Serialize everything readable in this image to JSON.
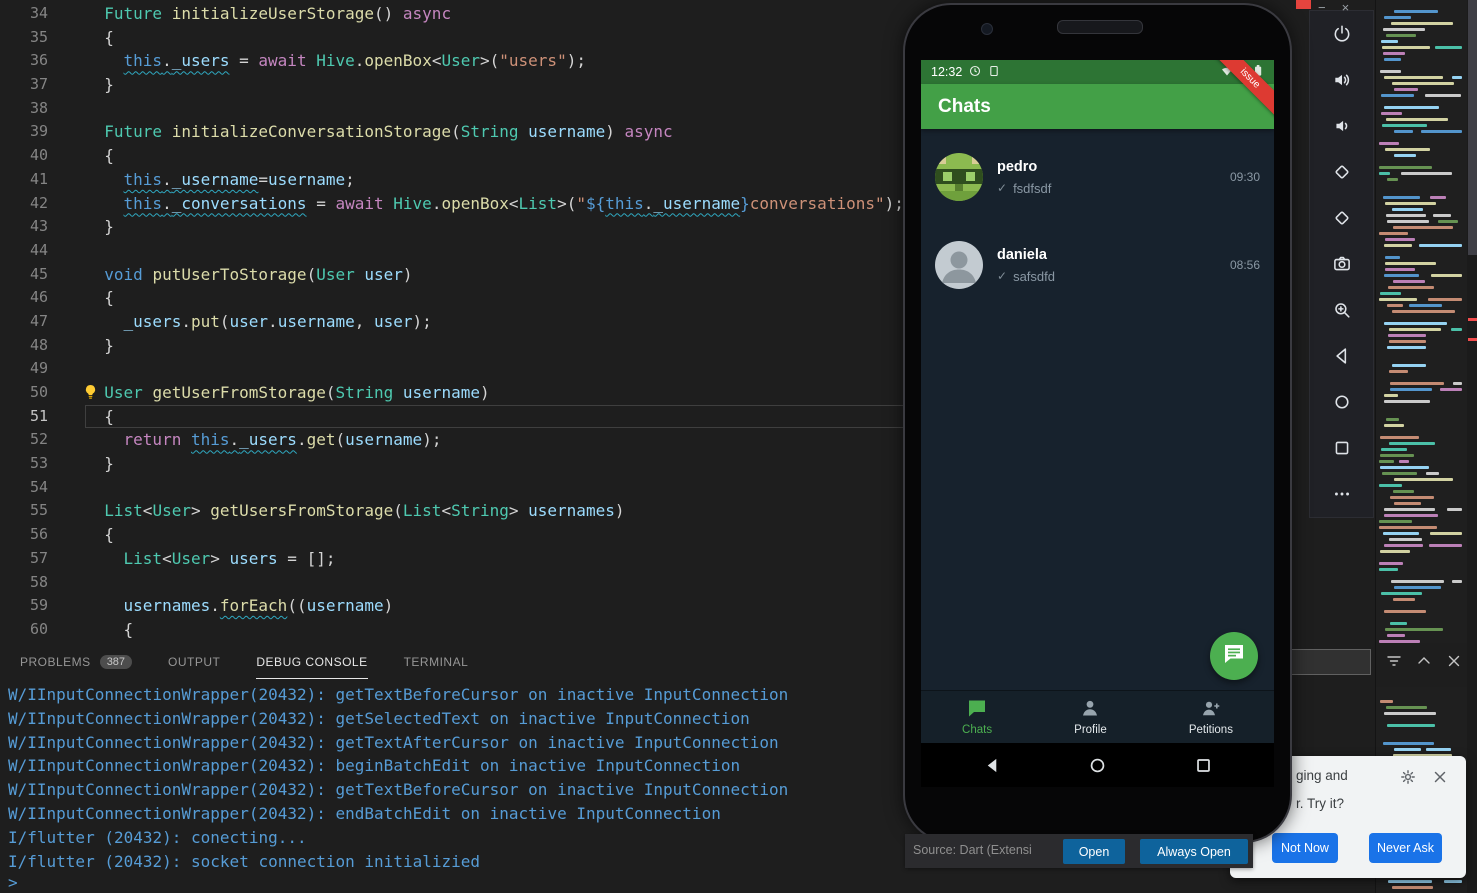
{
  "colors": {
    "app_bar_green": "#43A047",
    "status_bar_green": "#2D7434",
    "accent_green": "#4CAF50",
    "phone_bg_navy": "#17222D",
    "banner_red": "#DD3A32",
    "console_blue": "#569CD6",
    "vscode_button_blue": "#0E639C",
    "emulator_button_blue": "#1A73E8"
  },
  "editor": {
    "current_line": 51,
    "lightbulb_line": 50,
    "lines": [
      {
        "n": 34,
        "t": [
          [
            "  ",
            "pl"
          ],
          [
            "Future",
            "ty"
          ],
          [
            " ",
            "pl"
          ],
          [
            "initializeUserStorage",
            "fn"
          ],
          [
            "() ",
            "pl"
          ],
          [
            "async",
            "ctl"
          ]
        ]
      },
      {
        "n": 35,
        "t": [
          [
            "  {",
            "pl"
          ]
        ]
      },
      {
        "n": 36,
        "t": [
          [
            "    ",
            "pl"
          ],
          [
            "this",
            "kw",
            "w"
          ],
          [
            ".",
            "pl",
            "w"
          ],
          [
            "_users",
            "var",
            "w"
          ],
          [
            " = ",
            "pl"
          ],
          [
            "await",
            "ctl"
          ],
          [
            " ",
            "pl"
          ],
          [
            "Hive",
            "ty"
          ],
          [
            ".",
            "pl"
          ],
          [
            "openBox",
            "fn"
          ],
          [
            "<",
            "pl"
          ],
          [
            "User",
            "ty"
          ],
          [
            ">(",
            "pl"
          ],
          [
            "\"users\"",
            "str"
          ],
          [
            ");",
            "pl"
          ]
        ]
      },
      {
        "n": 37,
        "t": [
          [
            "  }",
            "pl"
          ]
        ]
      },
      {
        "n": 38,
        "t": []
      },
      {
        "n": 39,
        "t": [
          [
            "  ",
            "pl"
          ],
          [
            "Future",
            "ty"
          ],
          [
            " ",
            "pl"
          ],
          [
            "initializeConversationStorage",
            "fn"
          ],
          [
            "(",
            "pl"
          ],
          [
            "String",
            "ty"
          ],
          [
            " ",
            "pl"
          ],
          [
            "username",
            "var"
          ],
          [
            ") ",
            "pl"
          ],
          [
            "async",
            "ctl"
          ]
        ]
      },
      {
        "n": 40,
        "t": [
          [
            "  {",
            "pl"
          ]
        ]
      },
      {
        "n": 41,
        "t": [
          [
            "    ",
            "pl"
          ],
          [
            "this",
            "kw",
            "w"
          ],
          [
            ".",
            "pl",
            "w"
          ],
          [
            "_username",
            "var",
            "w"
          ],
          [
            "=",
            "pl"
          ],
          [
            "username",
            "var"
          ],
          [
            ";",
            "pl"
          ]
        ]
      },
      {
        "n": 42,
        "t": [
          [
            "    ",
            "pl"
          ],
          [
            "this",
            "kw",
            "w"
          ],
          [
            ".",
            "pl",
            "w"
          ],
          [
            "_conversations",
            "var",
            "w"
          ],
          [
            " = ",
            "pl"
          ],
          [
            "await",
            "ctl"
          ],
          [
            " ",
            "pl"
          ],
          [
            "Hive",
            "ty"
          ],
          [
            ".",
            "pl"
          ],
          [
            "openBox",
            "fn"
          ],
          [
            "<",
            "pl"
          ],
          [
            "List",
            "ty"
          ],
          [
            ">(",
            "pl"
          ],
          [
            "\"",
            "str"
          ],
          [
            "${",
            "kw"
          ],
          [
            "this",
            "kw",
            "w"
          ],
          [
            ".",
            "pl",
            "w"
          ],
          [
            "_username",
            "var",
            "w"
          ],
          [
            "}",
            "kw"
          ],
          [
            "conversations\"",
            "str"
          ],
          [
            ");",
            "pl"
          ]
        ]
      },
      {
        "n": 43,
        "t": [
          [
            "  }",
            "pl"
          ]
        ]
      },
      {
        "n": 44,
        "t": []
      },
      {
        "n": 45,
        "t": [
          [
            "  ",
            "pl"
          ],
          [
            "void",
            "kw"
          ],
          [
            " ",
            "pl"
          ],
          [
            "putUserToStorage",
            "fn"
          ],
          [
            "(",
            "pl"
          ],
          [
            "User",
            "ty"
          ],
          [
            " ",
            "pl"
          ],
          [
            "user",
            "var"
          ],
          [
            ")",
            "pl"
          ]
        ]
      },
      {
        "n": 46,
        "t": [
          [
            "  {",
            "pl"
          ]
        ]
      },
      {
        "n": 47,
        "t": [
          [
            "    ",
            "pl"
          ],
          [
            "_users",
            "var"
          ],
          [
            ".",
            "pl"
          ],
          [
            "put",
            "fn"
          ],
          [
            "(",
            "pl"
          ],
          [
            "user",
            "var"
          ],
          [
            ".",
            "pl"
          ],
          [
            "username",
            "var"
          ],
          [
            ", ",
            "pl"
          ],
          [
            "user",
            "var"
          ],
          [
            ");",
            "pl"
          ]
        ]
      },
      {
        "n": 48,
        "t": [
          [
            "  }",
            "pl"
          ]
        ]
      },
      {
        "n": 49,
        "t": []
      },
      {
        "n": 50,
        "t": [
          [
            "  ",
            "pl"
          ],
          [
            "User",
            "ty"
          ],
          [
            " ",
            "pl"
          ],
          [
            "getUserFromStorage",
            "fn"
          ],
          [
            "(",
            "pl"
          ],
          [
            "String",
            "ty"
          ],
          [
            " ",
            "pl"
          ],
          [
            "username",
            "var"
          ],
          [
            ")",
            "pl"
          ]
        ]
      },
      {
        "n": 51,
        "t": [
          [
            "  {",
            "pl"
          ]
        ]
      },
      {
        "n": 52,
        "t": [
          [
            "    ",
            "pl"
          ],
          [
            "return",
            "ctl"
          ],
          [
            " ",
            "pl"
          ],
          [
            "this",
            "kw",
            "w"
          ],
          [
            ".",
            "pl",
            "w"
          ],
          [
            "_users",
            "var",
            "w"
          ],
          [
            ".",
            "pl"
          ],
          [
            "get",
            "fn"
          ],
          [
            "(",
            "pl"
          ],
          [
            "username",
            "var"
          ],
          [
            ");",
            "pl"
          ]
        ]
      },
      {
        "n": 53,
        "t": [
          [
            "  }",
            "pl"
          ]
        ]
      },
      {
        "n": 54,
        "t": []
      },
      {
        "n": 55,
        "t": [
          [
            "  ",
            "pl"
          ],
          [
            "List",
            "ty"
          ],
          [
            "<",
            "pl"
          ],
          [
            "User",
            "ty"
          ],
          [
            "> ",
            "pl"
          ],
          [
            "getUsersFromStorage",
            "fn"
          ],
          [
            "(",
            "pl"
          ],
          [
            "List",
            "ty"
          ],
          [
            "<",
            "pl"
          ],
          [
            "String",
            "ty"
          ],
          [
            "> ",
            "pl"
          ],
          [
            "usernames",
            "var"
          ],
          [
            ")",
            "pl"
          ]
        ]
      },
      {
        "n": 56,
        "t": [
          [
            "  {",
            "pl"
          ]
        ]
      },
      {
        "n": 57,
        "t": [
          [
            "    ",
            "pl"
          ],
          [
            "List",
            "ty"
          ],
          [
            "<",
            "pl"
          ],
          [
            "User",
            "ty"
          ],
          [
            "> ",
            "pl"
          ],
          [
            "users",
            "var"
          ],
          [
            " = [];",
            "pl"
          ]
        ]
      },
      {
        "n": 58,
        "t": []
      },
      {
        "n": 59,
        "t": [
          [
            "    ",
            "pl"
          ],
          [
            "usernames",
            "var"
          ],
          [
            ".",
            "pl"
          ],
          [
            "forEach",
            "fn",
            "w"
          ],
          [
            "((",
            "pl"
          ],
          [
            "username",
            "var"
          ],
          [
            ")",
            "pl"
          ]
        ]
      },
      {
        "n": 60,
        "t": [
          [
            "    {",
            "pl"
          ]
        ]
      }
    ]
  },
  "panel": {
    "tabs": [
      {
        "label": "PROBLEMS",
        "badge": "387",
        "active": false
      },
      {
        "label": "OUTPUT",
        "active": false
      },
      {
        "label": "DEBUG CONSOLE",
        "active": true
      },
      {
        "label": "TERMINAL",
        "active": false
      }
    ],
    "console": [
      "W/IInputConnectionWrapper(20432): getTextBeforeCursor on inactive InputConnection",
      "W/IInputConnectionWrapper(20432): getSelectedText on inactive InputConnection",
      "W/IInputConnectionWrapper(20432): getTextAfterCursor on inactive InputConnection",
      "W/IInputConnectionWrapper(20432): beginBatchEdit on inactive InputConnection",
      "W/IInputConnectionWrapper(20432): getTextBeforeCursor on inactive InputConnection",
      "W/IInputConnectionWrapper(20432): endBatchEdit on inactive InputConnection",
      "I/flutter (20432): conecting...",
      "I/flutter (20432): socket connection initializied"
    ],
    "prompt": ">",
    "actions": [
      "filter",
      "collapse",
      "close"
    ]
  },
  "emulator": {
    "window_minimize": "−",
    "window_close": "×",
    "toolbar_icons": [
      "power",
      "volume-up",
      "volume-down",
      "rotate-left",
      "rotate-right",
      "screenshot",
      "zoom-in",
      "back",
      "home",
      "overview",
      "more"
    ],
    "phone": {
      "time": "12:32",
      "app_title": "Chats",
      "debug_banner": "issue",
      "chats": [
        {
          "name": "pedro",
          "check": "✓",
          "message": "fsdfsdf",
          "time": "09:30"
        },
        {
          "name": "daniela",
          "check": "✓",
          "message": "safsdfd",
          "time": "08:56"
        }
      ],
      "nav": [
        {
          "label": "Chats",
          "icon": "chat",
          "active": true
        },
        {
          "label": "Profile",
          "icon": "person",
          "active": false
        },
        {
          "label": "Petitions",
          "icon": "person-add",
          "active": false
        }
      ]
    },
    "dialog": {
      "text_line1": "ging and",
      "text_line2": "r. Try it?",
      "not_now": "Not Now",
      "never_ask": "Never Ask"
    }
  },
  "notification": {
    "source": "Source: Dart (Extensi",
    "open": "Open",
    "always_open": "Always Open"
  },
  "minimap": {
    "seed": 20432,
    "palette": [
      "#6a9955",
      "#9cdcfe",
      "#ce9178",
      "#d4d4d4",
      "#4ec9b0",
      "#c586c0",
      "#569cd6",
      "#dcdcaa"
    ]
  }
}
